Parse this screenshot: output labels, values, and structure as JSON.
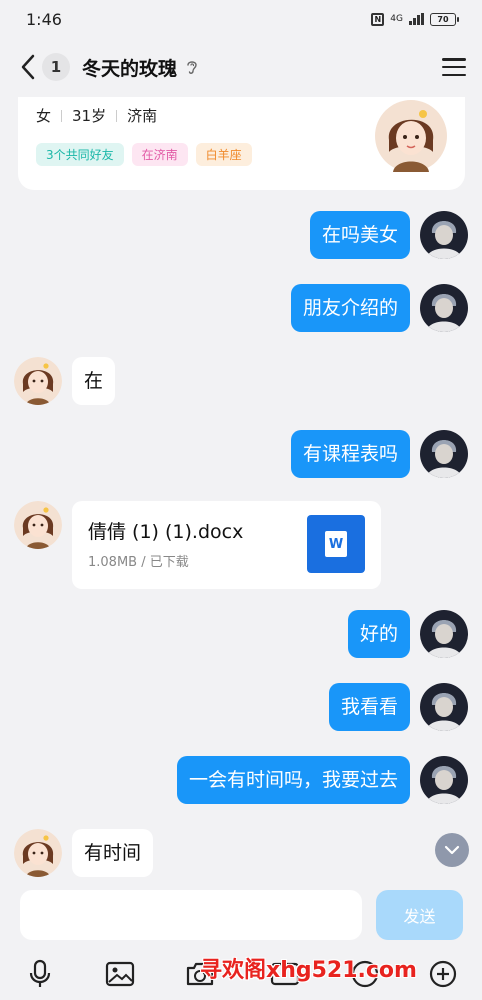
{
  "status_bar": {
    "time": "1:46",
    "signal": "4G",
    "battery": "70"
  },
  "header": {
    "unread_count": "1",
    "title": "冬天的玫瑰"
  },
  "profile": {
    "gender": "女",
    "age": "31岁",
    "city": "济南",
    "tags": [
      "3个共同好友",
      "在济南",
      "白羊座"
    ]
  },
  "messages": [
    {
      "dir": "out",
      "text": "在吗美女"
    },
    {
      "dir": "out",
      "text": "朋友介绍的"
    },
    {
      "dir": "in",
      "text": "在"
    },
    {
      "dir": "out",
      "text": "有课程表吗"
    },
    {
      "dir": "in",
      "type": "file",
      "file_name": "倩倩 (1) (1).docx",
      "file_meta": "1.08MB / 已下载",
      "file_icon_letter": "W"
    },
    {
      "dir": "out",
      "text": "好的"
    },
    {
      "dir": "out",
      "text": "我看看"
    },
    {
      "dir": "out",
      "text": "一会有时间吗，我要过去"
    },
    {
      "dir": "in",
      "text": "有时间"
    }
  ],
  "input": {
    "placeholder": "",
    "send_label": "发送"
  },
  "toolbar_icons": [
    "microphone-icon",
    "image-icon",
    "camera-icon",
    "gif-icon",
    "emoji-icon",
    "plus-icon"
  ],
  "watermark": "寻欢阁xhg521.com",
  "colors": {
    "outgoing_bubble": "#1996f9",
    "send_button": "#a9d9fb",
    "background": "#f2f2f4"
  }
}
